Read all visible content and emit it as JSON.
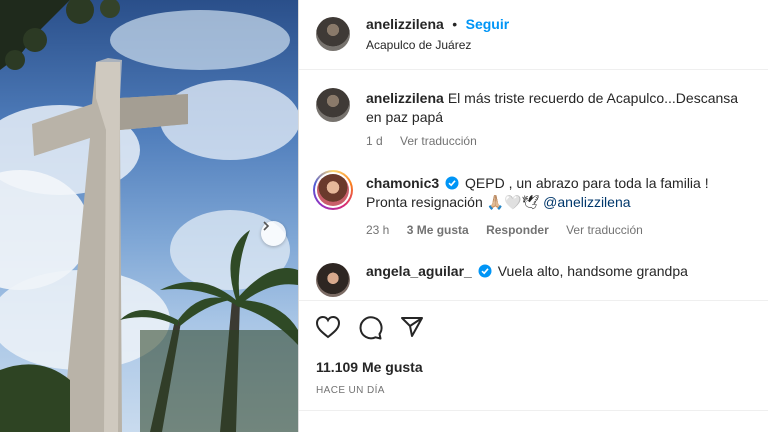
{
  "colors": {
    "link": "#0095f6",
    "mention": "#00376b",
    "muted": "#737373",
    "text": "#262626",
    "verified": "#0095f6"
  },
  "photo": {
    "next_icon": "chevron-right-icon"
  },
  "header": {
    "username": "anelizzilena",
    "separator": "•",
    "follow_label": "Seguir",
    "location": "Acapulco de Juárez"
  },
  "comments": [
    {
      "username": "anelizzilena",
      "text": "El más triste recuerdo de Acapulco...Descansa en paz papá",
      "time": "1 d",
      "translate": "Ver traducción"
    },
    {
      "username": "chamonic3",
      "verified": true,
      "text": "QEPD , un abrazo para toda la familia ! Pronta resignación 🙏🏼🤍🕊",
      "mention": "@anelizzilena",
      "time": "23 h",
      "likes": "3 Me gusta",
      "reply": "Responder",
      "translate": "Ver traducción"
    },
    {
      "username": "angela_aguilar_",
      "verified": true,
      "text": "Vuela alto, handsome grandpa"
    }
  ],
  "actions": {
    "like_icon": "heart-icon",
    "comment_icon": "comment-icon",
    "share_icon": "paper-plane-icon"
  },
  "likes_count": "11.109 Me gusta",
  "date_label": "HACE UN DÍA"
}
